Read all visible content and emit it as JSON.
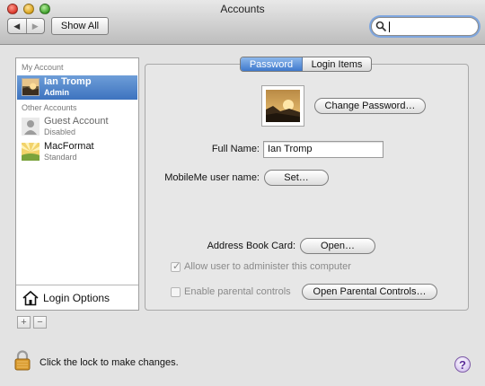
{
  "window": {
    "title": "Accounts"
  },
  "toolbar": {
    "show_all_label": "Show All",
    "search_value": "",
    "back_icon": "◀",
    "forward_icon": "▶"
  },
  "sidebar": {
    "my_account_header": "My Account",
    "other_accounts_header": "Other Accounts",
    "users": [
      {
        "name": "Ian Tromp",
        "role": "Admin"
      },
      {
        "name": "Guest Account",
        "role": "Disabled"
      },
      {
        "name": "MacFormat",
        "role": "Standard"
      }
    ],
    "login_options_label": "Login Options",
    "add_label": "+",
    "remove_label": "−"
  },
  "tabs": [
    {
      "label": "Password"
    },
    {
      "label": "Login Items"
    }
  ],
  "panel": {
    "change_password_label": "Change Password…",
    "full_name_label": "Full Name:",
    "full_name_value": "Ian Tromp",
    "mobileme_label": "MobileMe user name:",
    "set_label": "Set…",
    "address_book_label": "Address Book Card:",
    "open_label": "Open…",
    "allow_admin_label": "Allow user to administer this computer",
    "allow_admin_checked": true,
    "parental_label": "Enable parental controls",
    "parental_checked": false,
    "open_parental_label": "Open Parental Controls…"
  },
  "footer": {
    "lock_text": "Click the lock to make changes.",
    "help_label": "?"
  }
}
